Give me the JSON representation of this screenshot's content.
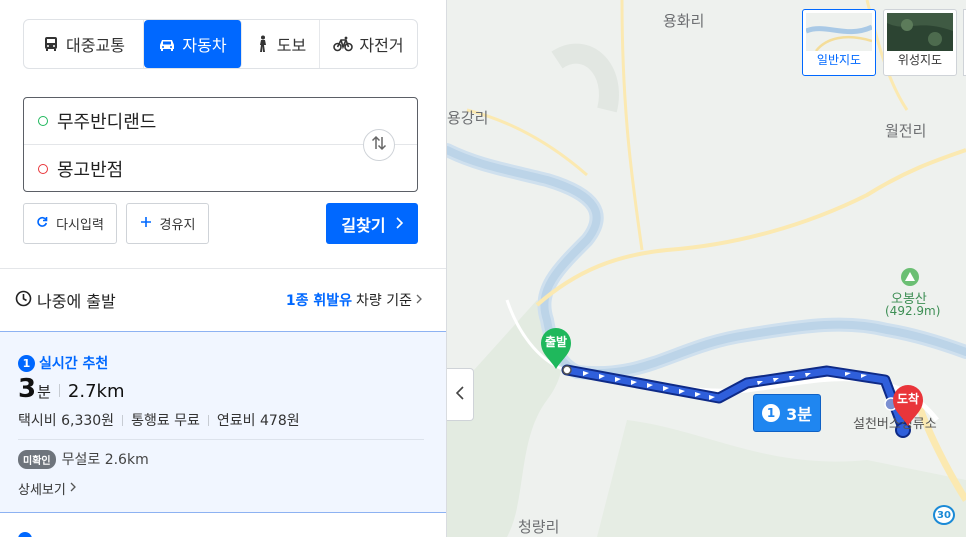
{
  "modes": [
    {
      "label": "대중교통",
      "icon": "bus-icon",
      "active": false
    },
    {
      "label": "자동차",
      "icon": "car-icon",
      "active": true
    },
    {
      "label": "도보",
      "icon": "walk-icon",
      "active": false
    },
    {
      "label": "자전거",
      "icon": "bicycle-icon",
      "active": false
    }
  ],
  "route": {
    "origin": "무주반디랜드",
    "destination": "몽고반점"
  },
  "buttons": {
    "reset": "다시입력",
    "waypoint": "경유지",
    "search": "길찾기"
  },
  "departure": {
    "label": "나중에 출발",
    "vehicle_highlight": "1종 휘발유",
    "vehicle_suffix": "차량 기준"
  },
  "result": {
    "rank": "1",
    "tag": "실시간 추천",
    "time_value": "3",
    "time_unit": "분",
    "distance": "2.7km",
    "taxi": "택시비 6,330원",
    "toll": "통행료 무료",
    "fuel": "연료비 478원",
    "road_badge": "미확인",
    "road": "무설로 2.6km",
    "detail": "상세보기"
  },
  "map": {
    "labels": {
      "yonghwa": "용화리",
      "yonggang": "용강리",
      "woljeon": "월전리",
      "obongsan": "오봉산",
      "obongsan_height": "(492.9m)",
      "seolcheon": "설천버스정류소",
      "cheongnyang": "청량리"
    },
    "map_types": [
      {
        "label": "일반지도",
        "selected": true
      },
      {
        "label": "위성지도",
        "selected": false
      }
    ],
    "start_pin": "출발",
    "end_pin": "도착",
    "route_badge_rank": "1",
    "route_badge_time": "3분",
    "road_number": "30"
  },
  "colors": {
    "accent": "#0068ff",
    "route": "#1c3fae",
    "start": "#1fb85c",
    "end": "#e9353a"
  }
}
